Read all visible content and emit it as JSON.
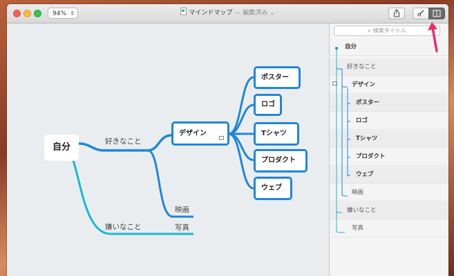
{
  "window": {
    "title": "マインドマップ",
    "status": "— 編集済み ⌄",
    "zoom": "94%"
  },
  "toolbar": {
    "share_icon": "share-icon",
    "style_icon": "brush-icon",
    "outline_icon": "sidebar-toggle-icon"
  },
  "canvas": {
    "root": "自分",
    "branch_like": "好きなこと",
    "branch_dislike": "嫌いなこと",
    "design": "デザイン",
    "movie": "映画",
    "photo": "写真",
    "children": [
      "ポスター",
      "ロゴ",
      "Tシャツ",
      "プロダクト",
      "ウェブ"
    ]
  },
  "sidebar": {
    "search_placeholder": "検索タイトル",
    "items": [
      "自分",
      "好きなこと",
      "デザイン",
      "ポスター",
      "ロゴ",
      "Tシャツ",
      "プロダクト",
      "ウェブ",
      "映画",
      "嫌いなこと",
      "写真"
    ]
  },
  "colors": {
    "accent": "#1f86d8",
    "teal": "#1ab8d0",
    "annotation_arrow": "#ee2a6a"
  }
}
